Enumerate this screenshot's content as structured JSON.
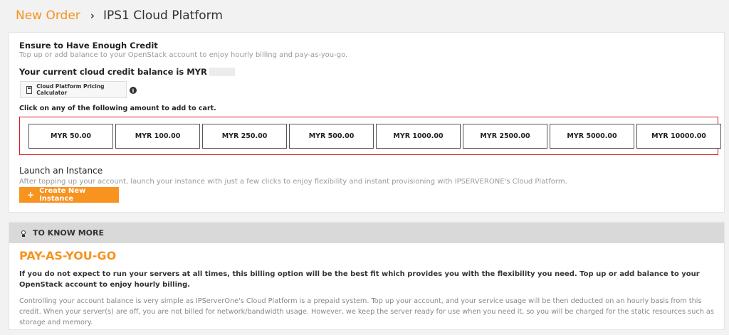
{
  "breadcrumb": {
    "parent": "New Order",
    "separator": "›",
    "current": "IPS1 Cloud Platform"
  },
  "credit": {
    "heading": "Ensure to Have Enough Credit",
    "subtext": "Top up or add balance to your OpenStack account to enjoy hourly billing and pay-as-you-go.",
    "balance_label": "Your current cloud credit balance is MYR",
    "calculator_label": "Cloud Platform Pricing Calculator",
    "info_glyph": "i",
    "click_label": "Click on any of the following amount to add to cart.",
    "amounts": [
      "MYR 50.00",
      "MYR 100.00",
      "MYR 250.00",
      "MYR 500.00",
      "MYR 1000.00",
      "MYR 2500.00",
      "MYR 5000.00",
      "MYR 10000.00"
    ],
    "highlight_color": "#d71920"
  },
  "launch": {
    "heading": "Launch an Instance",
    "subtext": "After topping up your account, launch your instance with just a few clicks to enjoy flexibility and instant provisioning with IPSERVERONE's Cloud Platform.",
    "button_icon": "+",
    "button_label": "Create New Instance",
    "button_color": "#f7931e"
  },
  "know_more": {
    "bar_label": "TO KNOW MORE",
    "title": "PAY-AS-YOU-GO",
    "bold_text": "If you do not expect to run your servers at all times, this billing option will be the best fit which provides you with the flexibility you need. Top up or add balance to your OpenStack account to enjoy hourly billing.",
    "body_text": "Controlling your account balance is very simple as IPServerOne's Cloud Platform is a prepaid system. Top up your account, and your service usage will be then deducted on an hourly basis from this credit. When your server(s) are off, you are not billed for network/bandwidth usage. However, we keep the server ready for use when you need it, so you will be charged for the static resources such as storage and memory."
  },
  "icons": {
    "calculator": "calculator-icon",
    "info": "info-icon",
    "bulb": "lightbulb-icon",
    "plus": "plus-icon"
  }
}
